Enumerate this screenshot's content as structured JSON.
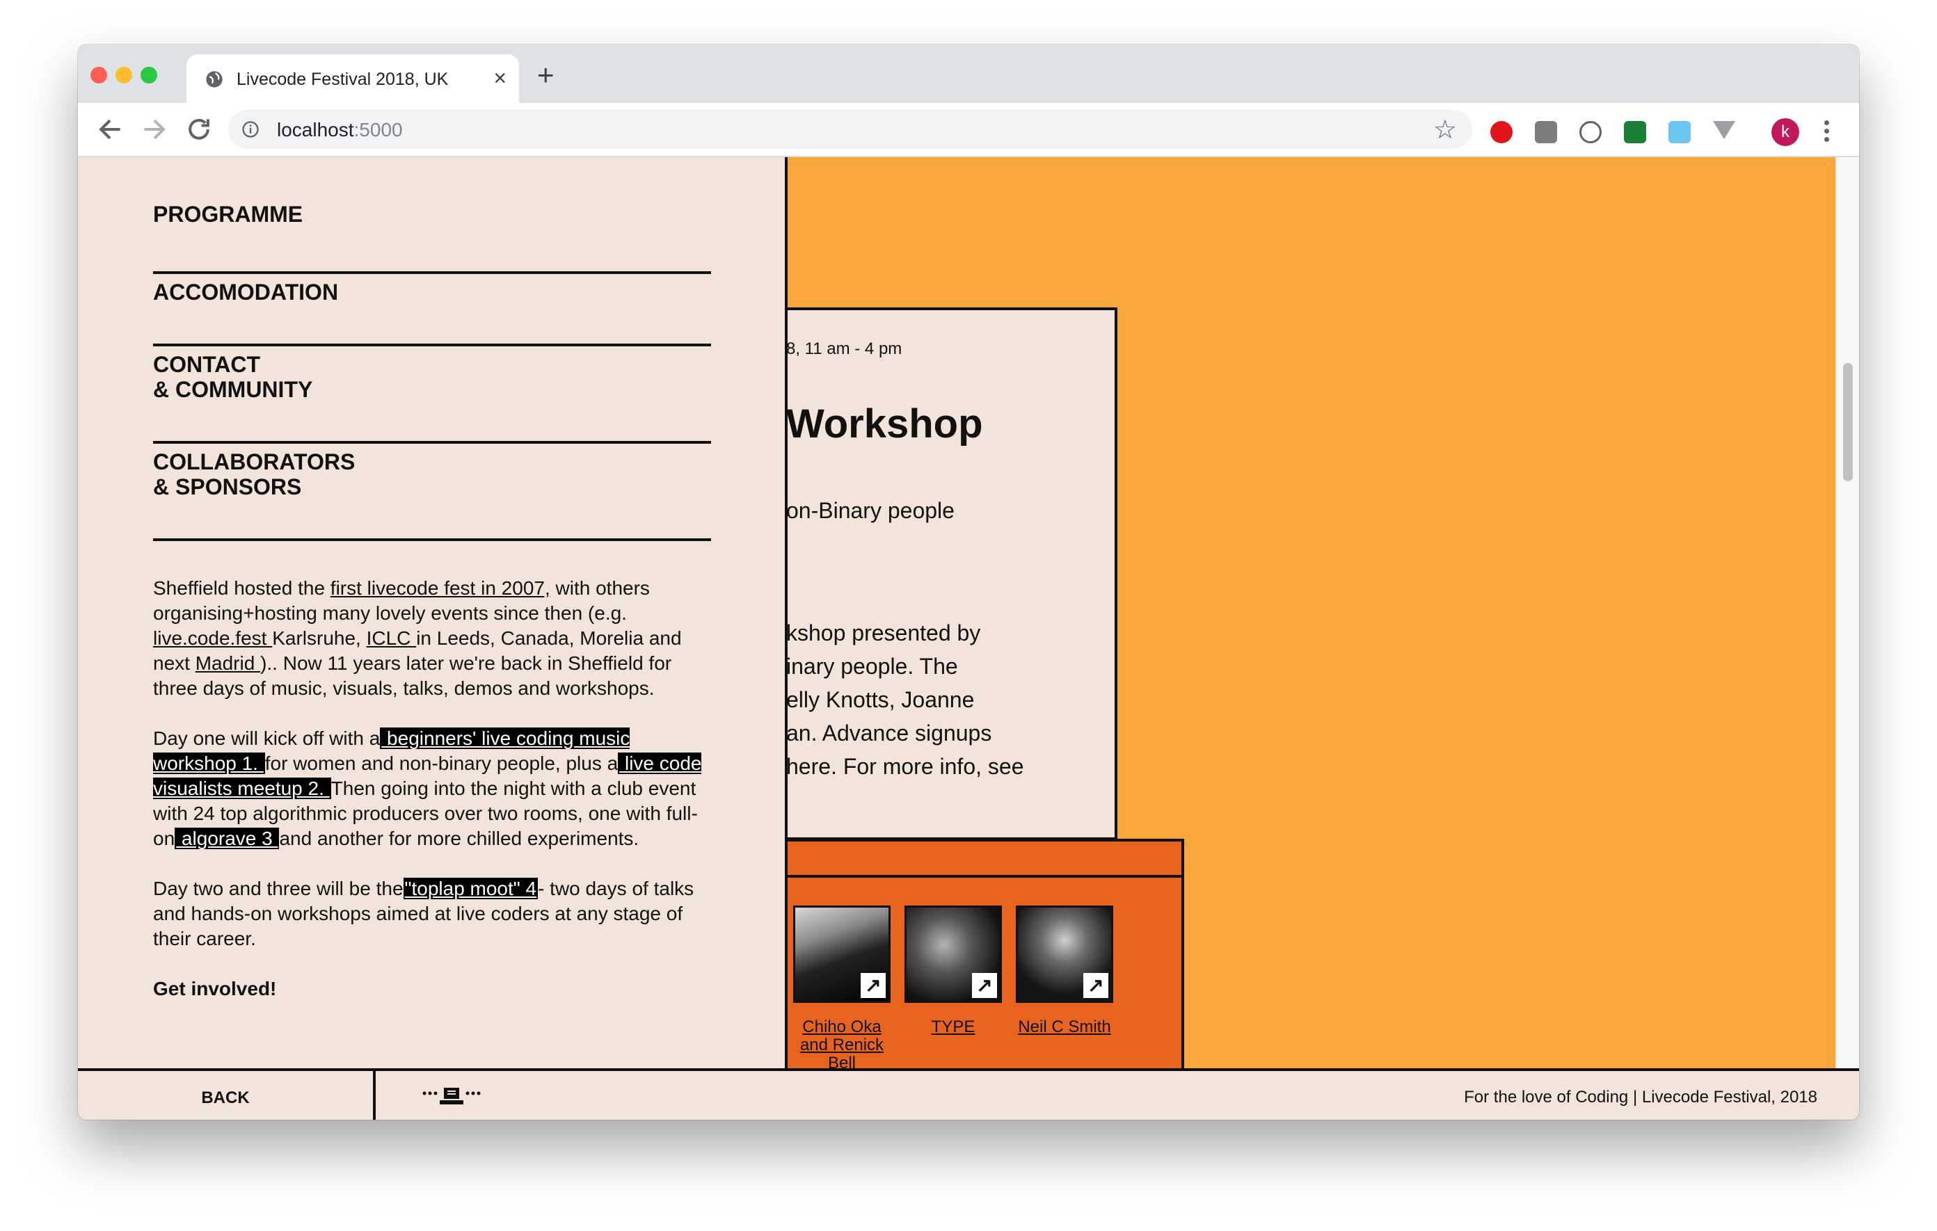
{
  "browser": {
    "tab_title": "Livecode Festival 2018, UK",
    "url_host": "localhost",
    "url_port": ":5000",
    "profile_initial": "k"
  },
  "nav": {
    "items": [
      "PROGRAMME",
      "ACCOMODATION",
      "CONTACT\n& COMMUNITY",
      "COLLABORATORS\n& SPONSORS"
    ]
  },
  "intro": {
    "p1_a": "Sheffield hosted the ",
    "p1_link1": "first livecode fest in 2007,",
    "p1_b": " with others organising+hosting many lovely events since then (e.g. ",
    "p1_link2": " live.code.fest ",
    "p1_c": "Karlsruhe, ",
    "p1_link3": " ICLC ",
    "p1_d": "in Leeds, Canada, Morelia and next ",
    "p1_link4": " Madrid ",
    "p1_e": ").. Now 11 years later we're back in Sheffield for three days of music, visuals, talks, demos and workshops.",
    "p2_a": "Day one will kick off with a",
    "p2_link1": " beginners' live coding music workshop 1. ",
    "p2_b": "for women and non-binary people, plus a",
    "p2_link2": " live code visualists meetup 2. ",
    "p2_c": "Then going into the night with a club event with 24 top algorithmic producers over two rooms, one with full-on",
    "p2_link3": " algorave 3 ",
    "p2_d": "and another for more chilled experiments.",
    "p3_a": "Day two and three will be the",
    "p3_link1": "\"toplap moot\" 4",
    "p3_b": "- two days of talks and hands-on workshops aimed at live coders at any stage of their career.",
    "cta": "Get involved!"
  },
  "event_card": {
    "date": "8, 11 am - 4 pm",
    "heading": "Workshop",
    "subtitle": "on-Binary people",
    "body": "kshop presented by\ninary people. The\nelly Knotts, Joanne\nan. Advance signups\nhere. For more info, see"
  },
  "artists": [
    {
      "name": "Chiho Oka and Renick Bell"
    },
    {
      "name": "TYPE"
    },
    {
      "name": "Neil C Smith"
    }
  ],
  "footer": {
    "back": "BACK",
    "credit": "For the love of Coding | Livecode Festival, 2018"
  },
  "colors": {
    "panel_bg": "#f2e4da",
    "orange": "#f9a63b",
    "dark_orange": "#e8641e",
    "ink": "#111111"
  }
}
